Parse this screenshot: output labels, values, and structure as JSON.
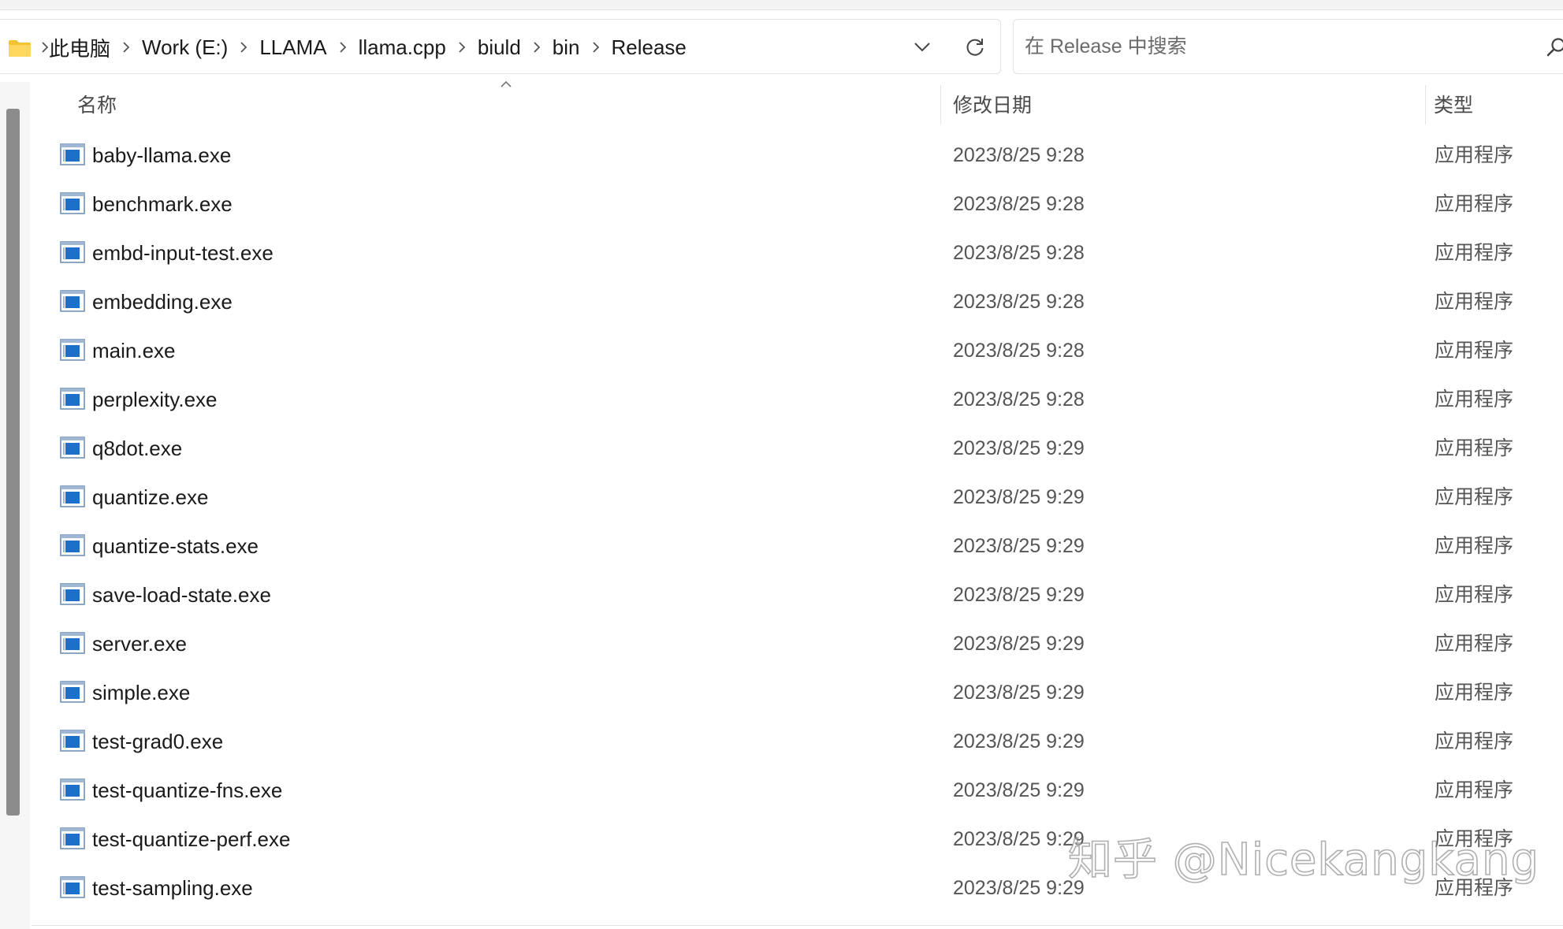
{
  "address_bar": {
    "breadcrumbs": [
      "此电脑",
      "Work (E:)",
      "LLAMA",
      "llama.cpp",
      "biuld",
      "bin",
      "Release"
    ]
  },
  "search": {
    "placeholder": "在 Release 中搜索"
  },
  "columns": {
    "name": "名称",
    "date_modified": "修改日期",
    "type": "类型"
  },
  "files": [
    {
      "name": "baby-llama.exe",
      "date": "2023/8/25 9:28",
      "type": "应用程序"
    },
    {
      "name": "benchmark.exe",
      "date": "2023/8/25 9:28",
      "type": "应用程序"
    },
    {
      "name": "embd-input-test.exe",
      "date": "2023/8/25 9:28",
      "type": "应用程序"
    },
    {
      "name": "embedding.exe",
      "date": "2023/8/25 9:28",
      "type": "应用程序"
    },
    {
      "name": "main.exe",
      "date": "2023/8/25 9:28",
      "type": "应用程序"
    },
    {
      "name": "perplexity.exe",
      "date": "2023/8/25 9:28",
      "type": "应用程序"
    },
    {
      "name": "q8dot.exe",
      "date": "2023/8/25 9:29",
      "type": "应用程序"
    },
    {
      "name": "quantize.exe",
      "date": "2023/8/25 9:29",
      "type": "应用程序"
    },
    {
      "name": "quantize-stats.exe",
      "date": "2023/8/25 9:29",
      "type": "应用程序"
    },
    {
      "name": "save-load-state.exe",
      "date": "2023/8/25 9:29",
      "type": "应用程序"
    },
    {
      "name": "server.exe",
      "date": "2023/8/25 9:29",
      "type": "应用程序"
    },
    {
      "name": "simple.exe",
      "date": "2023/8/25 9:29",
      "type": "应用程序"
    },
    {
      "name": "test-grad0.exe",
      "date": "2023/8/25 9:29",
      "type": "应用程序"
    },
    {
      "name": "test-quantize-fns.exe",
      "date": "2023/8/25 9:29",
      "type": "应用程序"
    },
    {
      "name": "test-quantize-perf.exe",
      "date": "2023/8/25 9:29",
      "type": "应用程序"
    },
    {
      "name": "test-sampling.exe",
      "date": "2023/8/25 9:29",
      "type": "应用程序"
    }
  ],
  "icons": {
    "folder": "folder-icon",
    "breadcrumb_separator": "chevron-right-icon",
    "history": "chevron-down-icon",
    "refresh": "refresh-icon",
    "search": "search-icon",
    "sort": "sort-ascending-icon",
    "file": "application-exe-icon"
  },
  "watermark": "知乎 @Nicekangkang",
  "colors": {
    "file_icon_blue": "#1e6fc8",
    "folder_yellow": "#f4c430",
    "scrollbar": "#8c8c8c"
  }
}
